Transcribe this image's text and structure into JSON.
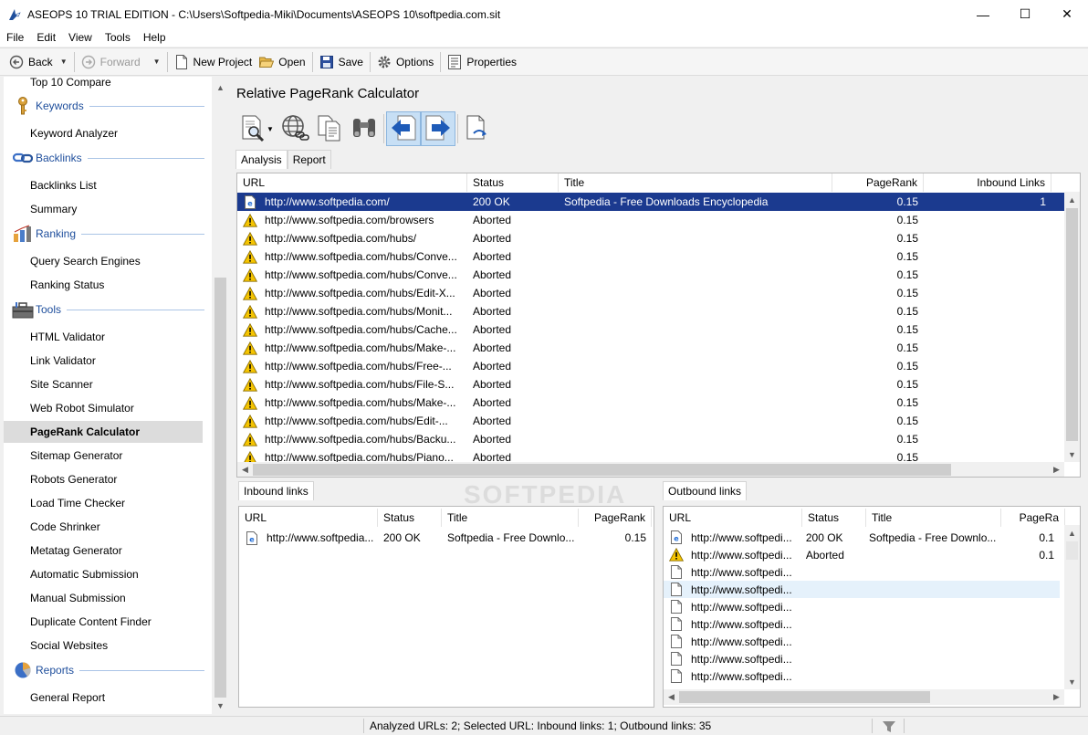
{
  "window": {
    "title": "ASEOPS 10 TRIAL EDITION - C:\\Users\\Softpedia-Miki\\Documents\\ASEOPS 10\\softpedia.com.sit",
    "minimize": "—",
    "maximize": "☐",
    "close": "✕"
  },
  "menu": [
    "File",
    "Edit",
    "View",
    "Tools",
    "Help"
  ],
  "toolbar": {
    "back": "Back",
    "forward": "Forward",
    "new_project": "New Project",
    "open": "Open",
    "save": "Save",
    "options": "Options",
    "properties": "Properties"
  },
  "sidebar": {
    "top_item": "Top 10 Compare",
    "keywords": {
      "label": "Keywords",
      "items": [
        "Keyword Analyzer"
      ]
    },
    "backlinks": {
      "label": "Backlinks",
      "items": [
        "Backlinks List",
        "Summary"
      ]
    },
    "ranking": {
      "label": "Ranking",
      "items": [
        "Query Search Engines",
        "Ranking Status"
      ]
    },
    "tools": {
      "label": "Tools",
      "items": [
        "HTML Validator",
        "Link Validator",
        "Site Scanner",
        "Web Robot Simulator",
        "PageRank Calculator",
        "Sitemap Generator",
        "Robots Generator",
        "Load Time Checker",
        "Code Shrinker",
        "Metatag Generator",
        "Automatic Submission",
        "Manual Submission",
        "Duplicate Content Finder",
        "Social Websites"
      ]
    },
    "reports": {
      "label": "Reports",
      "items": [
        "General Report"
      ]
    },
    "active_item": "PageRank Calculator"
  },
  "panel": {
    "title": "Relative PageRank Calculator",
    "tabs": [
      "Analysis",
      "Report"
    ],
    "active_tab": "Analysis"
  },
  "main_grid": {
    "columns": [
      "URL",
      "Status",
      "Title",
      "PageRank",
      "Inbound Links"
    ],
    "rows": [
      {
        "icon": "page-ie-icon",
        "url": "http://www.softpedia.com/",
        "status": "200 OK",
        "title": "Softpedia - Free Downloads Encyclopedia",
        "pagerank": "0.15",
        "inbound": "1"
      },
      {
        "icon": "warning-icon",
        "url": "http://www.softpedia.com/browsers",
        "status": "Aborted",
        "title": "",
        "pagerank": "0.15",
        "inbound": ""
      },
      {
        "icon": "warning-icon",
        "url": "http://www.softpedia.com/hubs/",
        "status": "Aborted",
        "title": "",
        "pagerank": "0.15",
        "inbound": ""
      },
      {
        "icon": "warning-icon",
        "url": "http://www.softpedia.com/hubs/Conve...",
        "status": "Aborted",
        "title": "",
        "pagerank": "0.15",
        "inbound": ""
      },
      {
        "icon": "warning-icon",
        "url": "http://www.softpedia.com/hubs/Conve...",
        "status": "Aborted",
        "title": "",
        "pagerank": "0.15",
        "inbound": ""
      },
      {
        "icon": "warning-icon",
        "url": "http://www.softpedia.com/hubs/Edit-X...",
        "status": "Aborted",
        "title": "",
        "pagerank": "0.15",
        "inbound": ""
      },
      {
        "icon": "warning-icon",
        "url": "http://www.softpedia.com/hubs/Monit...",
        "status": "Aborted",
        "title": "",
        "pagerank": "0.15",
        "inbound": ""
      },
      {
        "icon": "warning-icon",
        "url": "http://www.softpedia.com/hubs/Cache...",
        "status": "Aborted",
        "title": "",
        "pagerank": "0.15",
        "inbound": ""
      },
      {
        "icon": "warning-icon",
        "url": "http://www.softpedia.com/hubs/Make-...",
        "status": "Aborted",
        "title": "",
        "pagerank": "0.15",
        "inbound": ""
      },
      {
        "icon": "warning-icon",
        "url": "http://www.softpedia.com/hubs/Free-...",
        "status": "Aborted",
        "title": "",
        "pagerank": "0.15",
        "inbound": ""
      },
      {
        "icon": "warning-icon",
        "url": "http://www.softpedia.com/hubs/File-S...",
        "status": "Aborted",
        "title": "",
        "pagerank": "0.15",
        "inbound": ""
      },
      {
        "icon": "warning-icon",
        "url": "http://www.softpedia.com/hubs/Make-...",
        "status": "Aborted",
        "title": "",
        "pagerank": "0.15",
        "inbound": ""
      },
      {
        "icon": "warning-icon",
        "url": "http://www.softpedia.com/hubs/Edit-...",
        "status": "Aborted",
        "title": "",
        "pagerank": "0.15",
        "inbound": ""
      },
      {
        "icon": "warning-icon",
        "url": "http://www.softpedia.com/hubs/Backu...",
        "status": "Aborted",
        "title": "",
        "pagerank": "0.15",
        "inbound": ""
      },
      {
        "icon": "warning-icon",
        "url": "http://www.softpedia.com/hubs/Piano...",
        "status": "Aborted",
        "title": "",
        "pagerank": "0.15",
        "inbound": ""
      }
    ]
  },
  "inbound": {
    "tab": "Inbound links",
    "columns": [
      "URL",
      "Status",
      "Title",
      "PageRank"
    ],
    "rows": [
      {
        "icon": "page-ie-icon",
        "url": "http://www.softpedia...",
        "status": "200 OK",
        "title": "Softpedia - Free Downlo...",
        "pagerank": "0.15"
      }
    ]
  },
  "outbound": {
    "tab": "Outbound links",
    "columns": [
      "URL",
      "Status",
      "Title",
      "PageRa"
    ],
    "rows": [
      {
        "icon": "page-ie-icon",
        "url": "http://www.softpedi...",
        "status": "200 OK",
        "title": "Softpedia - Free Downlo...",
        "pagerank": "0.1"
      },
      {
        "icon": "warning-icon",
        "url": "http://www.softpedi...",
        "status": "Aborted",
        "title": "",
        "pagerank": "0.1"
      },
      {
        "icon": "blank-page-icon",
        "url": "http://www.softpedi...",
        "status": "",
        "title": "",
        "pagerank": ""
      },
      {
        "icon": "blank-page-icon",
        "url": "http://www.softpedi...",
        "status": "",
        "title": "",
        "pagerank": ""
      },
      {
        "icon": "blank-page-icon",
        "url": "http://www.softpedi...",
        "status": "",
        "title": "",
        "pagerank": ""
      },
      {
        "icon": "blank-page-icon",
        "url": "http://www.softpedi...",
        "status": "",
        "title": "",
        "pagerank": ""
      },
      {
        "icon": "blank-page-icon",
        "url": "http://www.softpedi...",
        "status": "",
        "title": "",
        "pagerank": ""
      },
      {
        "icon": "blank-page-icon",
        "url": "http://www.softpedi...",
        "status": "",
        "title": "",
        "pagerank": ""
      },
      {
        "icon": "blank-page-icon",
        "url": "http://www.softpedi...",
        "status": "",
        "title": "",
        "pagerank": ""
      }
    ],
    "hover_row": 3
  },
  "status_bar": {
    "text": "Analyzed URLs: 2; Selected URL: Inbound links: 1; Outbound links: 35"
  },
  "watermark": "SOFTPEDIA",
  "colors": {
    "selection": "#1b3a8f",
    "section_label": "#1e4e9c",
    "warning": "#f5c400"
  }
}
